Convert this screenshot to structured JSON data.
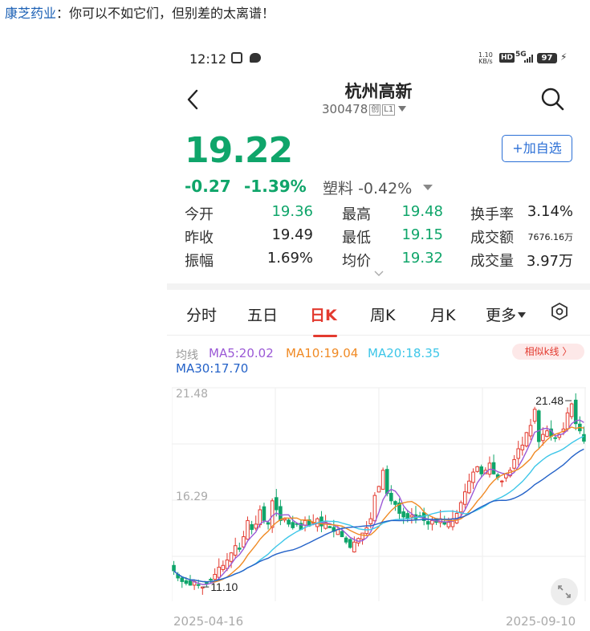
{
  "post": {
    "author": "康芝药业",
    "separator": "：",
    "text": "你可以不如它们，但别差的太离谱！"
  },
  "status_bar": {
    "time": "12:12",
    "net_speed_top": "1.10",
    "net_speed_bottom": "KB/s",
    "hd": "HD",
    "network": "5G",
    "battery": "97",
    "clock_icon": "alarm-icon",
    "msg_icon": "chat-icon",
    "charge_icon": "bolt-icon"
  },
  "header": {
    "title": "杭州高新",
    "code": "300478",
    "board_tag": "创",
    "level_tag": "L1",
    "back_icon": "chevron-left-icon",
    "search_icon": "search-icon"
  },
  "quote": {
    "price": "19.22",
    "change": "-0.27",
    "change_pct": "-1.39%",
    "sector_name": "塑料",
    "sector_change": "-0.42%",
    "add_button": "+加自选",
    "stats": [
      {
        "label": "今开",
        "value": "19.36"
      },
      {
        "label": "最高",
        "value": "19.48"
      },
      {
        "label": "换手率",
        "value": "3.14%"
      },
      {
        "label": "昨收",
        "value": "19.49"
      },
      {
        "label": "最低",
        "value": "19.15"
      },
      {
        "label": "成交额",
        "value": "7676.16万"
      },
      {
        "label": "振幅",
        "value": "1.69%"
      },
      {
        "label": "均价",
        "value": "19.32"
      },
      {
        "label": "成交量",
        "value": "3.97万"
      }
    ]
  },
  "tabs": [
    {
      "label": "分时"
    },
    {
      "label": "五日"
    },
    {
      "label": "日K",
      "active": true
    },
    {
      "label": "周K"
    },
    {
      "label": "月K"
    },
    {
      "label": "更多"
    }
  ],
  "indicators": {
    "prefix": "均线",
    "ma5": "MA5:20.02",
    "ma10": "MA10:19.04",
    "ma20": "MA20:18.35",
    "ma30": "MA30:17.70",
    "similar_button": "相似k线 〉"
  },
  "colors": {
    "up": "#e33a2f",
    "down": "#0fa56a",
    "ma5": "#9b59d6",
    "ma10": "#f08a24",
    "ma20": "#3dc6e8",
    "ma30": "#2462c8",
    "accent": "#2b6fd6"
  },
  "chart_data": {
    "type": "candlestick",
    "y_labels": [
      "21.48",
      "16.29"
    ],
    "x_labels": {
      "start": "2025-04-16",
      "end": "2025-09-10"
    },
    "annotations": {
      "max": "21.48",
      "min": "11.10"
    },
    "ylim": [
      10.3,
      22.2
    ],
    "closes": [
      12.0,
      11.6,
      11.4,
      11.3,
      11.2,
      11.4,
      11.2,
      11.1,
      11.3,
      11.5,
      11.8,
      12.2,
      12.3,
      12.6,
      13.0,
      13.4,
      13.2,
      13.9,
      14.8,
      14.3,
      14.6,
      15.4,
      14.8,
      14.6,
      15.9,
      15.4,
      14.8,
      14.9,
      14.6,
      14.4,
      14.6,
      14.3,
      14.8,
      14.5,
      14.7,
      14.9,
      14.5,
      14.7,
      14.4,
      14.2,
      14.3,
      13.9,
      13.6,
      13.3,
      13.6,
      13.8,
      14.1,
      14.4,
      14.9,
      16.2,
      16.7,
      17.6,
      16.3,
      15.9,
      15.7,
      15.2,
      15.0,
      14.9,
      15.1,
      14.9,
      15.0,
      14.8,
      14.6,
      14.8,
      14.7,
      14.9,
      14.6,
      14.7,
      14.9,
      15.2,
      15.8,
      16.4,
      17.0,
      17.5,
      17.8,
      17.4,
      17.6,
      18.0,
      17.4,
      17.2,
      17.0,
      17.4,
      17.6,
      18.2,
      18.8,
      19.0,
      19.7,
      20.1,
      21.0,
      19.2,
      19.6,
      19.8,
      19.5,
      19.4,
      19.6,
      19.9,
      20.8,
      21.3,
      20.2,
      19.8,
      19.22
    ],
    "ma5": "MA5:20.02",
    "ma10": "MA10:19.04",
    "ma20": "MA20:18.35",
    "ma30": "MA30:17.70"
  }
}
